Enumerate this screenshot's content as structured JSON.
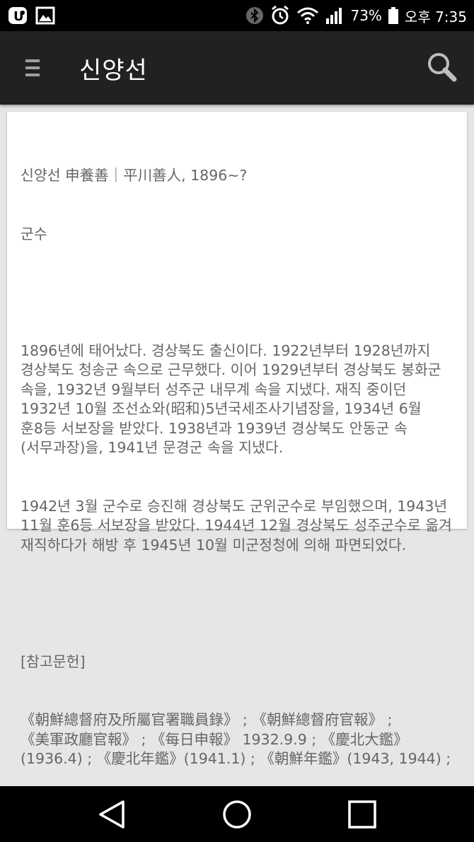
{
  "status_bar": {
    "battery": "73%",
    "time": "오후 7:35",
    "icons": [
      "notification-u-icon",
      "gallery-icon",
      "bluetooth-icon",
      "alarm-icon",
      "wifi-icon",
      "signal-icon",
      "battery-icon"
    ]
  },
  "app_bar": {
    "title": "신양선",
    "menu_icon": "menu-icon",
    "search_icon": "search-icon"
  },
  "entry": {
    "heading": "신양선 申養善｜平川善人, 1896~?",
    "role": "군수",
    "paragraph1": "1896년에 태어났다. 경상북도 출신이다. 1922년부터 1928년까지 경상북도 청송군 속으로 근무했다. 이어 1929년부터 경상북도 봉화군 속을, 1932년 9월부터 성주군 내무계 속을 지냈다. 재직 중이던 1932년 10월 조선쇼와(昭和)5년국세조사기념장을, 1934년 6월 훈8등 서보장을 받았다. 1938년과 1939년 경상북도 안동군 속(서무과장)을, 1941년 문경군 속을 지냈다.",
    "paragraph2": "1942년 3월 군수로 승진해 경상북도 군위군수로 부임했으며, 1943년 11월 훈6등 서보장을 받았다. 1944년 12월 경상북도 성주군수로 옮겨 재직하다가 해방 후 1945년 10월 미군정청에 의해 파면되었다.",
    "references_label": "[참고문헌]",
    "references": "《朝鮮總督府及所屬官署職員錄》 ; 《朝鮮總督府官報》 ; 《美軍政廳官報》 ; 《每日申報》 1932.9.9 ; 《慶北大鑑》(1936.4) ; 《慶北年鑑》(1941.1) ; 《朝鮮年鑑》(1943, 1944) ;"
  },
  "nav_bar": {
    "buttons": [
      "back-icon",
      "home-icon",
      "recents-icon"
    ]
  }
}
